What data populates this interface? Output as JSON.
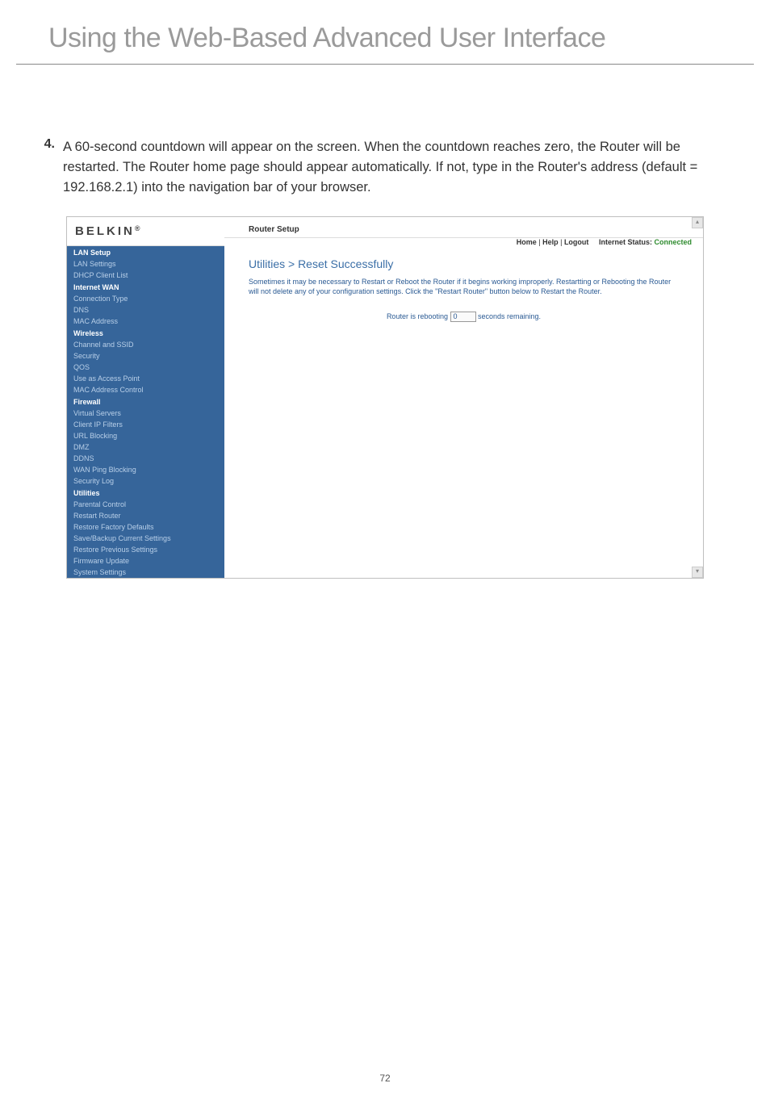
{
  "page": {
    "title": "Using the Web-Based Advanced User Interface",
    "number": "72"
  },
  "step": {
    "num": "4.",
    "text": "A 60-second countdown will appear on the screen. When the countdown reaches zero, the Router will be restarted. The Router home page should appear automatically. If not, type in the Router's address (default = 192.168.2.1) into the navigation bar of your browser."
  },
  "router": {
    "logo": "BELKIN",
    "logo_suffix": "®",
    "header_title": "Router Setup",
    "breadcrumb": {
      "home": "Home",
      "help": "Help",
      "logout": "Logout",
      "status_label": "Internet Status:",
      "status_value": "Connected"
    },
    "section_heading": "Utilities > Reset Successfully",
    "desc": "Sometimes it may be necessary to Restart or Reboot the Router if it begins working improperly. Restartting or Rebooting the Router will not delete any of your configuration settings. Click the \"Restart Router\" button below to Restart the Router.",
    "reboot_prefix": "Router is rebooting",
    "reboot_value": "0",
    "reboot_suffix": "seconds remaining.",
    "sidebar": {
      "groups": [
        {
          "label": "LAN Setup",
          "items": [
            "LAN Settings",
            "DHCP Client List"
          ]
        },
        {
          "label": "Internet WAN",
          "items": [
            "Connection Type",
            "DNS",
            "MAC Address"
          ]
        },
        {
          "label": "Wireless",
          "items": [
            "Channel and SSID",
            "Security",
            "QOS",
            "Use as Access Point",
            "MAC Address Control"
          ]
        },
        {
          "label": "Firewall",
          "items": [
            "Virtual Servers",
            "Client IP Filters",
            "URL Blocking",
            "DMZ",
            "DDNS",
            "WAN Ping Blocking",
            "Security Log"
          ]
        },
        {
          "label": "Utilities",
          "items": [
            "Parental Control",
            "Restart Router",
            "Restore Factory Defaults",
            "Save/Backup Current Settings",
            "Restore Previous Settings",
            "Firmware Update",
            "System Settings"
          ]
        }
      ]
    }
  }
}
